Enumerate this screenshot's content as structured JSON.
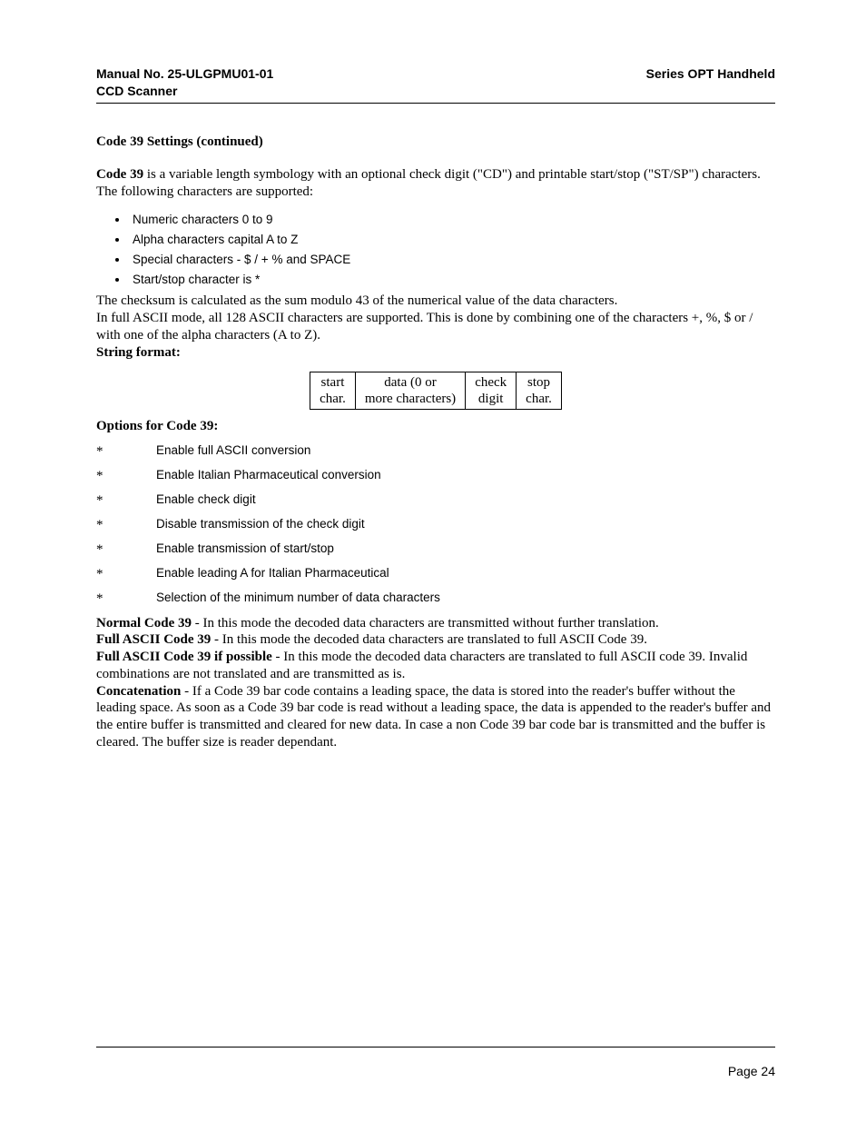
{
  "header": {
    "left_line1": "Manual No. 25-ULGPMU01-01",
    "left_line2": "CCD Scanner",
    "right": "Series OPT Handheld"
  },
  "section_title": "Code 39 Settings (continued)",
  "intro": {
    "bold": "Code 39",
    "rest": " is a variable length symbology with an optional check digit (\"CD\") and printable start/stop (\"ST/SP\") characters. The following characters are supported:"
  },
  "bullets": [
    "Numeric characters 0 to 9",
    "Alpha characters capital A to Z",
    "Special characters - $ / + % and SPACE",
    "Start/stop character is *"
  ],
  "after_list": {
    "l1": "The checksum is calculated as the sum modulo 43 of the numerical value of the data characters.",
    "l2": "In full ASCII mode, all 128 ASCII characters are supported. This is done by combining one of the characters +, %, $ or / with one of the alpha characters (A to Z)."
  },
  "string_format_label": "String format:",
  "string_table": {
    "c1a": "start",
    "c1b": "char.",
    "c2a": "data (0 or",
    "c2b": "more characters)",
    "c3a": "check",
    "c3b": "digit",
    "c4a": "stop",
    "c4b": "char."
  },
  "options_title": "Options for Code 39:",
  "options": [
    "Enable full ASCII conversion",
    "Enable Italian Pharmaceutical conversion",
    "Enable check digit",
    "Disable transmission of the check digit",
    "Enable transmission of start/stop",
    "Enable leading A for Italian Pharmaceutical",
    "Selection of the minimum number of data characters"
  ],
  "modes": {
    "m1b": "Normal Code 39",
    "m1t": " - In this mode the decoded data characters are transmitted without further translation.",
    "m2b": "Full ASCII Code 39",
    "m2t": " - In this mode the decoded data characters are translated to full ASCII Code 39.",
    "m3b": "Full ASCII Code 39 if possible",
    "m3t": " - In this mode the decoded data characters are translated to full ASCII code 39. Invalid combinations are not translated and are transmitted as is.",
    "m4b": "Concatenation",
    "m4t": " - If a Code 39 bar code contains a leading space, the data is stored into the reader's buffer without the leading space. As soon as a Code 39 bar code is read without a leading space, the data is appended to the reader's buffer and the entire buffer is transmitted and cleared for new data. In case a non Code 39 bar code bar is transmitted and the buffer is cleared. The buffer size is reader dependant."
  },
  "page_number": "Page 24",
  "star": "*"
}
